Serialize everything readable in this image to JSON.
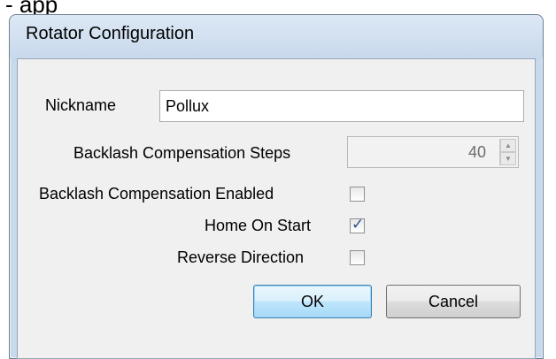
{
  "peek_text": "- app",
  "window": {
    "title": "Rotator Configuration"
  },
  "form": {
    "nickname_label": "Nickname",
    "nickname_value": "Pollux",
    "backlash_steps_label": "Backlash Compensation Steps",
    "backlash_steps_value": "40",
    "backlash_enabled_label": "Backlash Compensation Enabled",
    "backlash_enabled_checked": false,
    "home_on_start_label": "Home On Start",
    "home_on_start_checked": true,
    "reverse_direction_label": "Reverse Direction",
    "reverse_direction_checked": false
  },
  "buttons": {
    "ok_label": "OK",
    "cancel_label": "Cancel"
  },
  "icons": {
    "check": "✓",
    "spin_up": "▲",
    "spin_down": "▼"
  }
}
